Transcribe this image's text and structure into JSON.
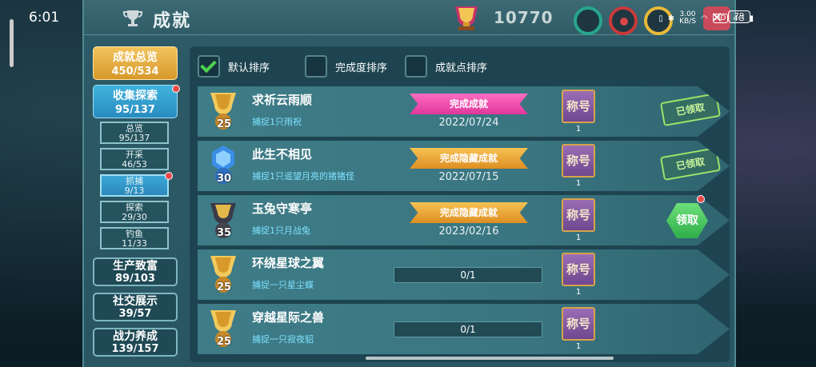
{
  "status_bar": {
    "time": "6:01",
    "net_speed_value": "3.00",
    "net_speed_unit": "KB/S",
    "hd": "HD",
    "signal": "4G",
    "battery": "79"
  },
  "header": {
    "title": "成就",
    "score": "10770"
  },
  "tabs": [
    {
      "label": "成就总览",
      "count": "450/534"
    },
    {
      "label": "收集探索",
      "count": "95/137"
    },
    {
      "label": "生产致富",
      "count": "89/103"
    },
    {
      "label": "社交展示",
      "count": "39/57"
    },
    {
      "label": "战力养成",
      "count": "139/157"
    }
  ],
  "sub_tabs": [
    {
      "label": "总览",
      "count": "95/137"
    },
    {
      "label": "开采",
      "count": "46/53"
    },
    {
      "label": "抓捕",
      "count": "9/13"
    },
    {
      "label": "探索",
      "count": "29/30"
    },
    {
      "label": "钓鱼",
      "count": "11/33"
    }
  ],
  "sort": {
    "default": "默认排序",
    "completion": "完成度排序",
    "points": "成就点排序"
  },
  "achievements": [
    {
      "title": "求祈云雨顺",
      "desc": "捕捉1只雨祝",
      "points": "25",
      "ribbon": "完成成就",
      "date": "2022/07/24",
      "badge": "称号",
      "badge_count": "1",
      "claim": "已领取"
    },
    {
      "title": "此生不相见",
      "desc": "捕捉1只遥望月亮的猪猪怪",
      "points": "30",
      "ribbon": "完成隐藏成就",
      "date": "2022/07/15",
      "badge": "称号",
      "badge_count": "1",
      "claim": "已领取"
    },
    {
      "title": "玉兔守寒亭",
      "desc": "捕捉1只月战兔",
      "points": "35",
      "ribbon": "完成隐藏成就",
      "date": "2023/02/16",
      "badge": "称号",
      "badge_count": "1",
      "claim": "领取"
    },
    {
      "title": "环绕星球之翼",
      "desc": "捕捉一只星尘蝶",
      "points": "25",
      "progress": "0/1",
      "badge": "称号",
      "badge_count": "1"
    },
    {
      "title": "穿越星际之兽",
      "desc": "捕捉一只寂夜貂",
      "points": "25",
      "progress": "0/1",
      "badge": "称号",
      "badge_count": "1"
    }
  ],
  "colors": {
    "panel": "#2d5a66",
    "gold_tab": "#d7992b",
    "blue_tab": "#2a8cc0",
    "pink_ribbon": "#e0379b",
    "gold_ribbon": "#dd8e22",
    "desc_text": "#7ee0ff"
  },
  "icons": {
    "header": "trophy-icon",
    "medal": "medal-icon",
    "back": "close-icon"
  }
}
